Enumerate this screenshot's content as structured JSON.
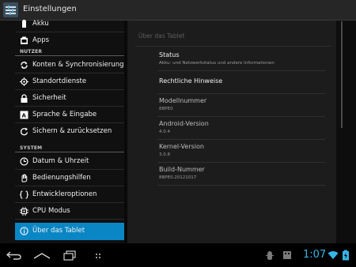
{
  "actionbar": {
    "title": "Einstellungen"
  },
  "sidebar": {
    "items_top": [
      {
        "label": "Akku",
        "icon": "battery-icon"
      },
      {
        "label": "Apps",
        "icon": "apps-icon"
      }
    ],
    "section_user": "NUTZER",
    "items_user": [
      {
        "label": "Konten & Synchronisierung",
        "icon": "sync-icon"
      },
      {
        "label": "Standortdienste",
        "icon": "location-icon"
      },
      {
        "label": "Sicherheit",
        "icon": "lock-icon"
      },
      {
        "label": "Sprache & Eingabe",
        "icon": "language-icon"
      },
      {
        "label": "Sichern & zurücksetzen",
        "icon": "backup-icon"
      }
    ],
    "section_system": "SYSTEM",
    "items_system": [
      {
        "label": "Datum & Uhrzeit",
        "icon": "clock-icon"
      },
      {
        "label": "Bedienungshilfen",
        "icon": "accessibility-icon"
      },
      {
        "label": "Entwickleroptionen",
        "icon": "developer-icon"
      },
      {
        "label": "CPU Modus",
        "icon": "cpu-icon"
      },
      {
        "label": "Über das Tablet",
        "icon": "info-icon",
        "selected": true
      }
    ]
  },
  "detail": {
    "breadcrumb": "Über das Tablet",
    "status_title": "Status",
    "status_summary": "Akku- und Netzwerkstatus und andere Informationen",
    "legal_title": "Rechtliche Hinweise",
    "model_label": "Modellnummer",
    "model_value": "8BPE0",
    "android_label": "Android-Version",
    "android_value": "4.0.4",
    "kernel_label": "Kernel-Version",
    "kernel_value": "3.0.8",
    "build_label": "Build-Nummer",
    "build_value": "8BPE0.20121017"
  },
  "systembar": {
    "clock": "1:07"
  },
  "colors": {
    "accent": "#0a86c4",
    "clock": "#34b5e5"
  }
}
